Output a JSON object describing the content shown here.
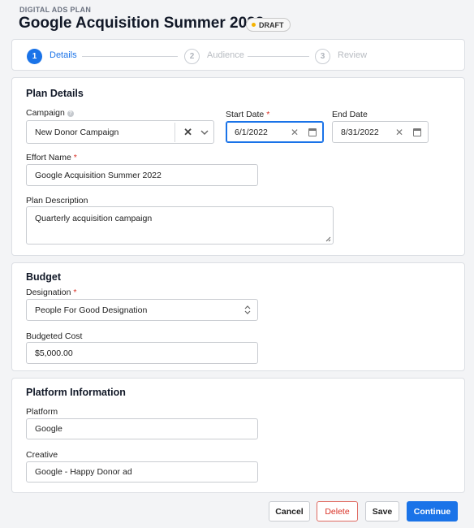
{
  "header": {
    "eyebrow": "DIGITAL ADS PLAN",
    "title": "Google Acquisition Summer 2022",
    "status_badge": "DRAFT"
  },
  "stepper": {
    "steps": [
      {
        "number": "1",
        "label": "Details",
        "state": "active"
      },
      {
        "number": "2",
        "label": "Audience",
        "state": "inactive"
      },
      {
        "number": "3",
        "label": "Review",
        "state": "inactive"
      }
    ]
  },
  "plan_details": {
    "title": "Plan Details",
    "campaign": {
      "label": "Campaign",
      "value": "New Donor Campaign"
    },
    "start_date": {
      "label": "Start Date",
      "required_mark": "*",
      "value": "6/1/2022"
    },
    "end_date": {
      "label": "End Date",
      "value": "8/31/2022"
    },
    "effort_name": {
      "label": "Effort Name",
      "required_mark": "*",
      "value": "Google Acquisition Summer 2022"
    },
    "plan_description": {
      "label": "Plan Description",
      "value": "Quarterly acquisition campaign"
    }
  },
  "budget": {
    "title": "Budget",
    "designation": {
      "label": "Designation",
      "required_mark": "*",
      "value": "People For Good Designation"
    },
    "budgeted_cost": {
      "label": "Budgeted Cost",
      "value": "$5,000.00"
    }
  },
  "platform_info": {
    "title": "Platform Information",
    "platform": {
      "label": "Platform",
      "value": "Google"
    },
    "creative": {
      "label": "Creative",
      "value": "Google - Happy Donor ad"
    }
  },
  "footer": {
    "cancel": "Cancel",
    "delete": "Delete",
    "save": "Save",
    "continue": "Continue"
  },
  "colors": {
    "accent": "#1a73e8",
    "danger": "#d93025",
    "draft_dot": "#f5b300"
  },
  "icons": {
    "help": "question-circle-icon",
    "clear": "close-icon",
    "dropdown": "chevron-down-icon",
    "calendar": "calendar-icon",
    "sort": "up-down-chevron-icon",
    "resize": "resize-grip-icon"
  }
}
